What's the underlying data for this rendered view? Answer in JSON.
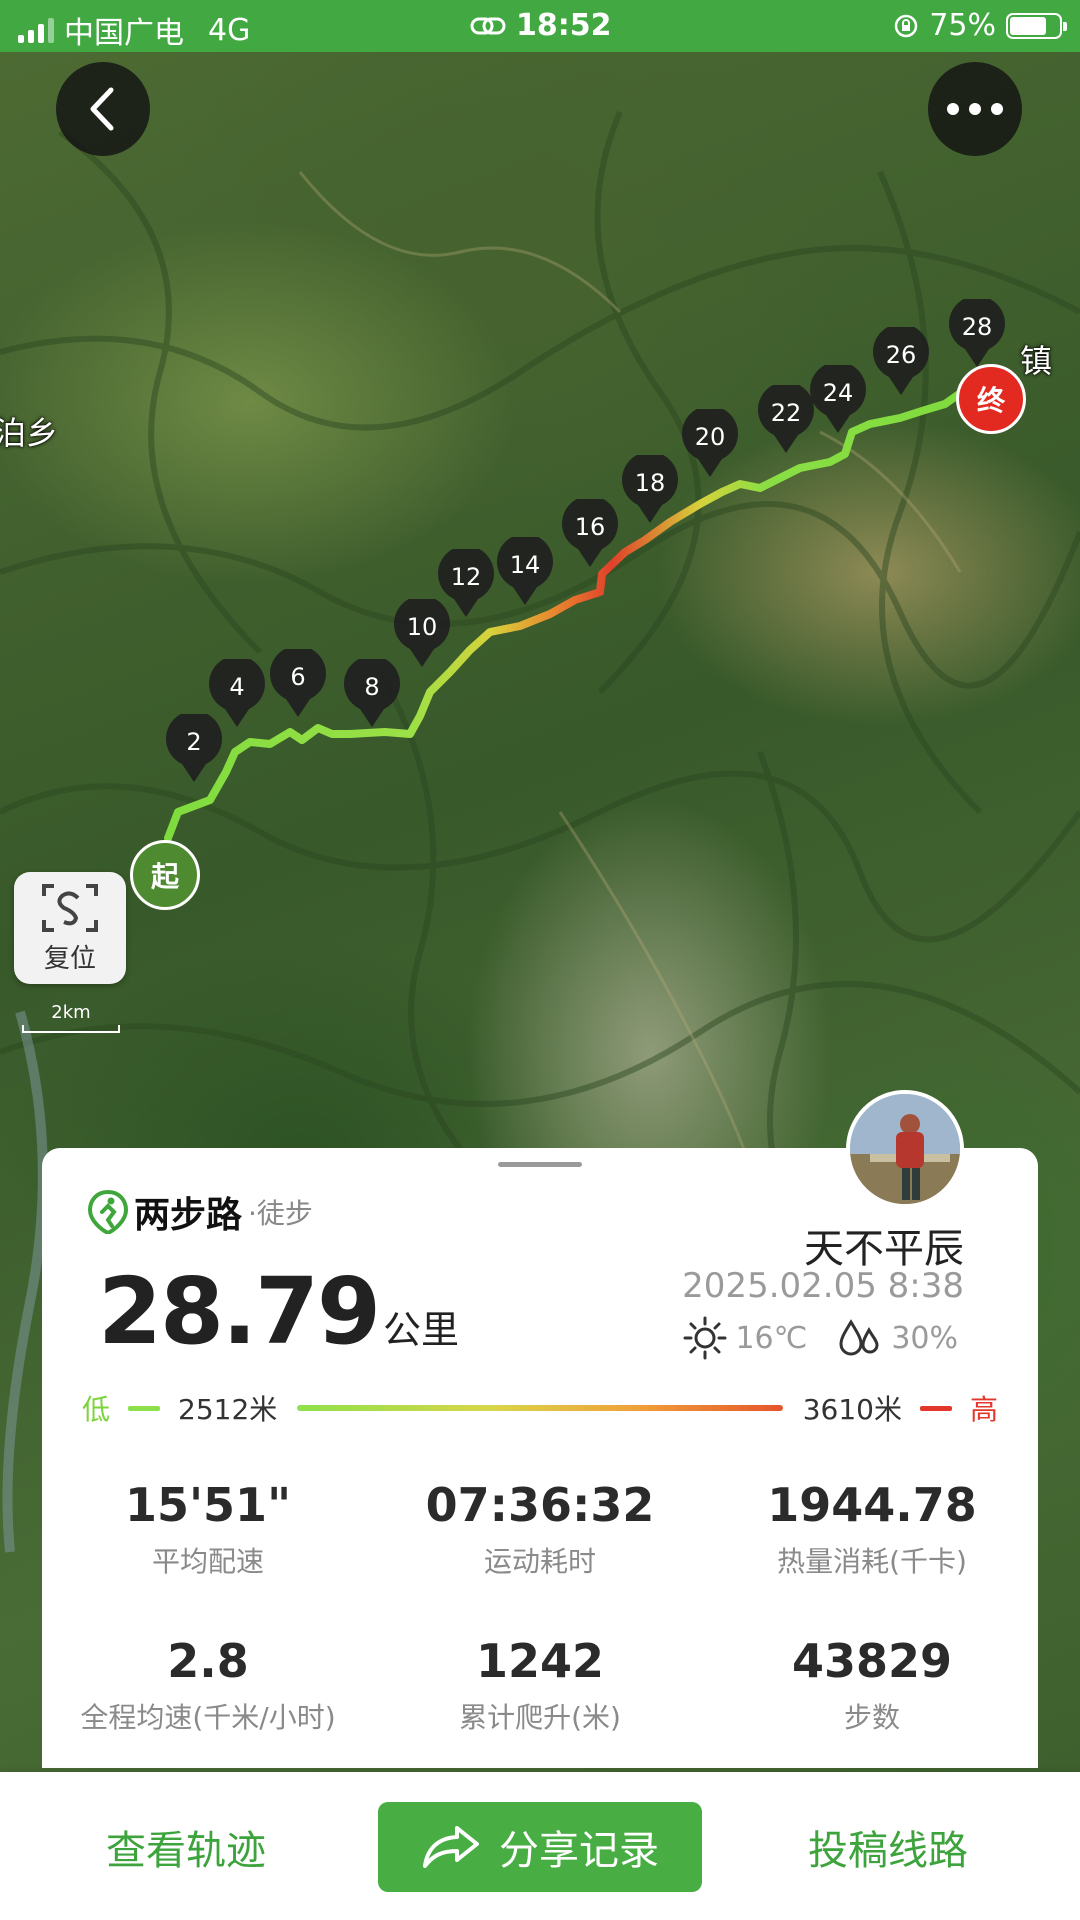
{
  "status_bar": {
    "carrier": "中国广电",
    "network": "4G",
    "time": "18:52",
    "battery": "75%",
    "battery_level": 0.75
  },
  "map": {
    "labels": [
      "泊乡",
      "镇"
    ],
    "reset_label": "复位",
    "scale_label": "2km",
    "start_label": "起",
    "end_label": "终",
    "km_markers": [
      "2",
      "4",
      "6",
      "8",
      "10",
      "12",
      "14",
      "16",
      "18",
      "20",
      "22",
      "24",
      "26",
      "28"
    ],
    "route_colors": {
      "low": "#7fdc3e",
      "mid": "#d7d23b",
      "high": "#e0402a"
    }
  },
  "card": {
    "brand": "两步路",
    "activity": "·徒步",
    "user_name": "天不平辰",
    "distance": "28.79",
    "distance_unit": "公里",
    "date": "2025.02.05 8:38",
    "temperature": "16℃",
    "humidity": "30%",
    "elevation": {
      "low_label": "低",
      "low_value": "2512米",
      "high_value": "3610米",
      "high_label": "高"
    },
    "stats": [
      {
        "value": "15'51\"",
        "label": "平均配速"
      },
      {
        "value": "07:36:32",
        "label": "运动耗时"
      },
      {
        "value": "1944.78",
        "label": "热量消耗(千卡)"
      },
      {
        "value": "2.8",
        "label": "全程均速(千米/小时)"
      },
      {
        "value": "1242",
        "label": "累计爬升(米)"
      },
      {
        "value": "43829",
        "label": "步数"
      }
    ]
  },
  "bottom_bar": {
    "view_track": "查看轨迹",
    "share": "分享记录",
    "submit_route": "投稿线路"
  }
}
